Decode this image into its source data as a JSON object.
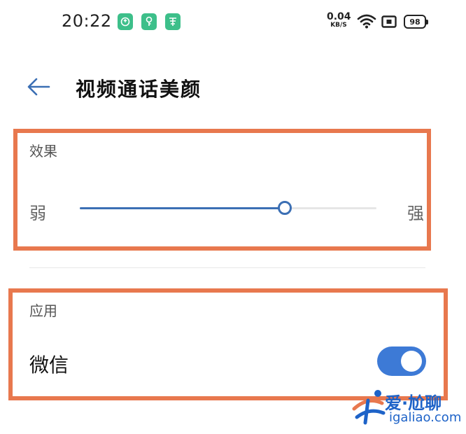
{
  "status_bar": {
    "time": "20:22",
    "notifications": [
      {
        "icon": "notification-app-icon-1",
        "color": "#3dbf8a"
      },
      {
        "icon": "notification-app-icon-2",
        "color": "#3dbf8a"
      },
      {
        "icon": "notification-app-icon-3",
        "color": "#3dbf8a"
      }
    ],
    "net_speed_value": "0.04",
    "net_speed_unit": "KB/S",
    "battery": "98"
  },
  "header": {
    "back_icon": "arrow-left-icon",
    "title": "视频通话美颜"
  },
  "effect": {
    "section_label": "效果",
    "min_label": "弱",
    "max_label": "强",
    "slider_value": 0.69,
    "accent": "#3b6fb4"
  },
  "apps": {
    "section_label": "应用",
    "items": [
      {
        "label": "微信",
        "enabled": true
      }
    ],
    "toggle_color": "#3d7ad6"
  },
  "watermark": {
    "text": "爱·尬聊",
    "url": "igaliao.com"
  }
}
